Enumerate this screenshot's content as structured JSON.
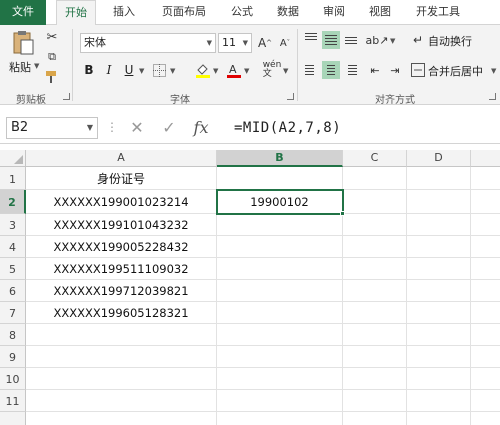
{
  "tabs": [
    "文件",
    "开始",
    "插入",
    "页面布局",
    "公式",
    "数据",
    "审阅",
    "视图",
    "开发工具"
  ],
  "ribbon": {
    "paste_label": "粘贴",
    "clipboard_label": "剪贴板",
    "font_name": "宋体",
    "font_size": "11",
    "bold": "B",
    "italic": "I",
    "underline": "U",
    "font_label": "字体",
    "wrap_text": "自动换行",
    "merge_center": "合并后居中",
    "alignment_label": "对齐方式",
    "accent": "#217346"
  },
  "formula_bar": {
    "name_box": "B2",
    "formula": "=MID(A2,7,8)"
  },
  "columns": [
    "A",
    "B",
    "C",
    "D"
  ],
  "rows": [
    "1",
    "2",
    "3",
    "4",
    "5",
    "6",
    "7",
    "8",
    "9",
    "10",
    "11"
  ],
  "cells": {
    "A1": "身份证号",
    "A2": "XXXXXX199001023214",
    "A3": "XXXXXX199101043232",
    "A4": "XXXXXX199005228432",
    "A5": "XXXXXX199511109032",
    "A6": "XXXXXX199712039821",
    "A7": "XXXXXX199605128321",
    "B2": "19900102"
  }
}
